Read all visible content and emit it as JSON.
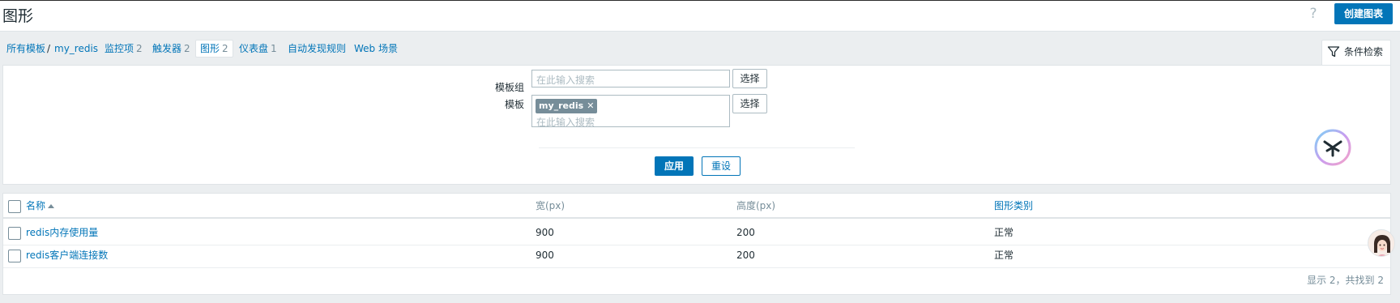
{
  "header": {
    "title": "图形",
    "help_icon": "?",
    "create_button": "创建图表"
  },
  "nav": {
    "all_templates": "所有模板",
    "separator": "/",
    "template_name": "my_redis",
    "items": [
      {
        "label": "监控项",
        "count": "2"
      },
      {
        "label": "触发器",
        "count": "2"
      },
      {
        "label": "图形",
        "count": "2"
      },
      {
        "label": "仪表盘",
        "count": "1"
      },
      {
        "label": "自动发现规则",
        "count": ""
      },
      {
        "label": "Web 场景",
        "count": ""
      }
    ]
  },
  "filter": {
    "tab_label": "条件检索",
    "template_group_label": "模板组",
    "template_group_placeholder": "在此输入搜索",
    "template_label": "模板",
    "template_tag": "my_redis",
    "template_placeholder": "在此输入搜索",
    "select_button": "选择",
    "apply_button": "应用",
    "reset_button": "重设"
  },
  "table": {
    "columns": [
      "名称",
      "宽(px)",
      "高度(px)",
      "图形类别"
    ],
    "rows": [
      {
        "name": "redis内存使用量",
        "width": "900",
        "height": "200",
        "type": "正常"
      },
      {
        "name": "redis客户端连接数",
        "width": "900",
        "height": "200",
        "type": "正常"
      }
    ],
    "footer": "显示 2，共找到 2"
  },
  "colors": {
    "accent": "#0275b8",
    "muted": "#768d99",
    "border": "#dfe4e7",
    "background": "#ebeef0"
  }
}
